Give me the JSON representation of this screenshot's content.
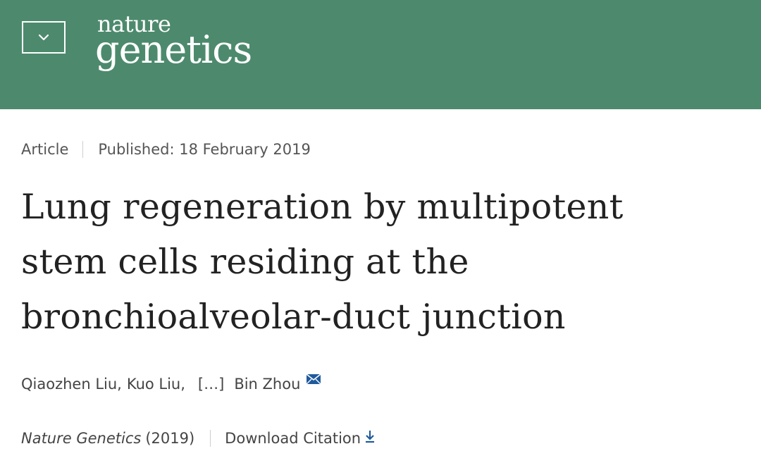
{
  "header": {
    "menu_icon": "chevron-down-icon",
    "logo_top": "nature",
    "logo_bottom": "genetics",
    "background": "#4d8a6d"
  },
  "article": {
    "type": "Article",
    "published": "Published: 18 February 2019",
    "title_lines": [
      "Lung regeneration by multipotent",
      "stem cells residing at the",
      "bronchioalveolar-duct junction"
    ],
    "authors": {
      "first": "Qiaozhen Liu,",
      "second": "Kuo Liu,",
      "ellipsis": "[…]",
      "last": "Bin Zhou",
      "contact_icon": "mail-icon"
    },
    "journal_name": "Nature Genetics",
    "journal_year": "(2019)",
    "download_label": "Download Citation",
    "download_icon": "download-icon"
  }
}
